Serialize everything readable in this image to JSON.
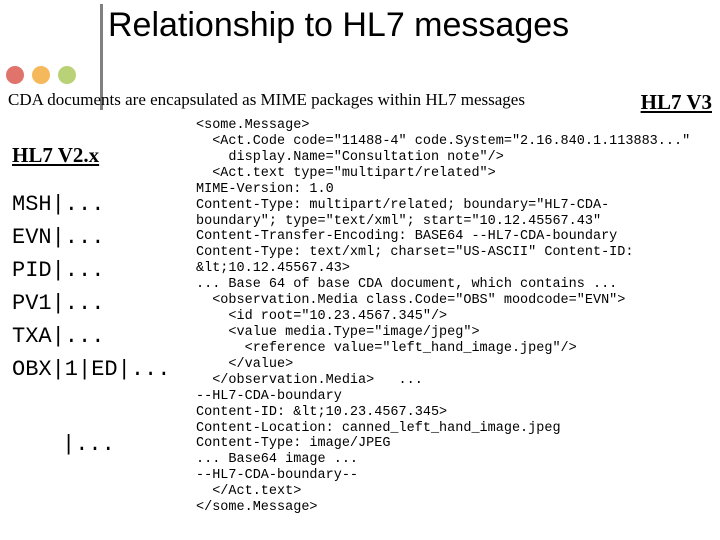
{
  "slide": {
    "title": "Relationship to HL7 messages",
    "subtitle": "CDA documents are encapsulated as MIME packages within HL7 messages",
    "left_heading": "HL7 V2.x",
    "right_heading": "HL7 V3",
    "v2_segments": "MSH|...\nEVN|...\nPID|...\nPV1|...\nTXA|...\nOBX|1|ED|...",
    "v2_tail": "|...",
    "v3_xml": "<some.Message>\n  <Act.Code code=\"11488-4\" code.System=\"2.16.840.1.113883...\"\n    display.Name=\"Consultation note\"/>\n  <Act.text type=\"multipart/related\">\nMIME-Version: 1.0\nContent-Type: multipart/related; boundary=\"HL7-CDA-\nboundary\"; type=\"text/xml\"; start=\"10.12.45567.43\"\nContent-Transfer-Encoding: BASE64 --HL7-CDA-boundary\nContent-Type: text/xml; charset=\"US-ASCII\" Content-ID:\n&lt;10.12.45567.43>\n... Base 64 of base CDA document, which contains ...\n  <observation.Media class.Code=\"OBS\" moodcode=\"EVN\">\n    <id root=\"10.23.4567.345\"/>\n    <value media.Type=\"image/jpeg\">\n      <reference value=\"left_hand_image.jpeg\"/>\n    </value>\n  </observation.Media>   ...\n--HL7-CDA-boundary\nContent-ID: &lt;10.23.4567.345>\nContent-Location: canned_left_hand_image.jpeg\nContent-Type: image/JPEG\n... Base64 image ...\n--HL7-CDA-boundary--\n  </Act.text>\n</some.Message>"
  }
}
